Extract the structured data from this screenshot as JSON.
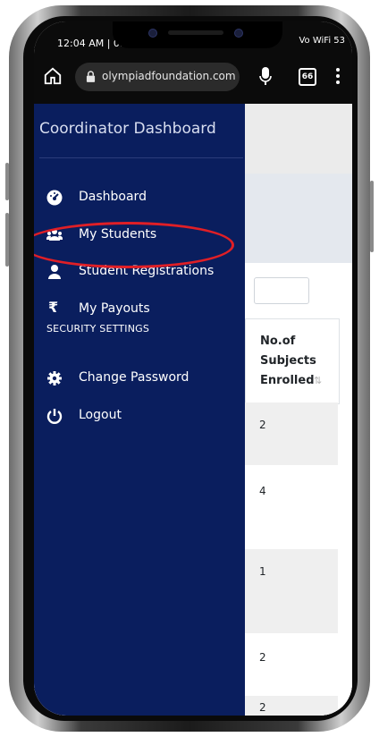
{
  "status_bar": {
    "time": "12:04 AM | 0.",
    "indicators": "Vo WiFi  53"
  },
  "browser": {
    "url": "olympiadfoundation.com",
    "tab_count": "66"
  },
  "drawer": {
    "title": "Coordinator Dashboard",
    "items": [
      {
        "label": "Dashboard",
        "icon": "dashboard-icon"
      },
      {
        "label": "My Students",
        "icon": "users-icon"
      },
      {
        "label": "Student Registrations",
        "icon": "user-icon"
      },
      {
        "label": "My Payouts",
        "icon": "rupee-icon"
      }
    ],
    "section_label": "SECURITY SETTINGS",
    "security_items": [
      {
        "label": "Change Password",
        "icon": "gear-icon"
      },
      {
        "label": "Logout",
        "icon": "power-icon"
      }
    ]
  },
  "table": {
    "header": "No.of Subjects Enrolled",
    "values": [
      "2",
      "4",
      "1",
      "2",
      "2"
    ]
  },
  "colors": {
    "drawer_bg": "#0a1e5e",
    "highlight": "#e01f26"
  }
}
